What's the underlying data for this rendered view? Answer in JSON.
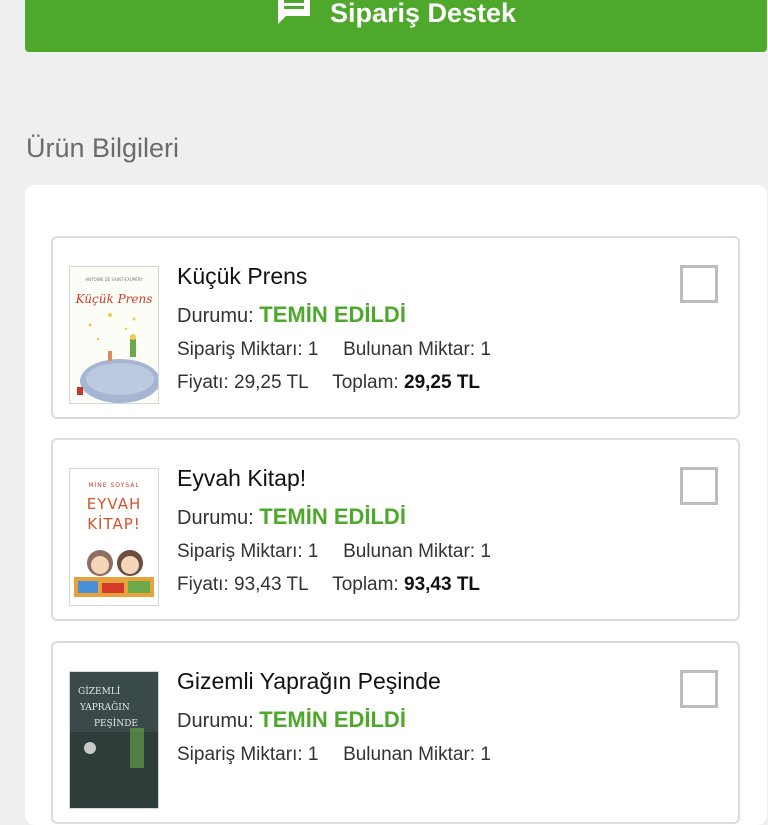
{
  "support_button": {
    "label": "Sipariş Destek",
    "icon": "chat-icon",
    "color": "#4ea82c"
  },
  "section": {
    "title": "Ürün Bilgileri"
  },
  "labels": {
    "status": "Durumu:",
    "order_qty": "Sipariş Miktarı:",
    "found_qty": "Bulunan Miktar:",
    "price": "Fiyatı:",
    "total": "Toplam:"
  },
  "products": [
    {
      "title": "Küçük Prens",
      "status": "TEMİN EDİLDİ",
      "order_qty": "1",
      "found_qty": "1",
      "price": "29,25 TL",
      "total": "29,25 TL",
      "cover_text": "Küçük Prens"
    },
    {
      "title": "Eyvah Kitap!",
      "status": "TEMİN EDİLDİ",
      "order_qty": "1",
      "found_qty": "1",
      "price": "93,43 TL",
      "total": "93,43 TL",
      "cover_author": "MİNE SOYSAL",
      "cover_title_1": "EYVAH",
      "cover_title_2": "KİTAP!"
    },
    {
      "title": "Gizemli Yaprağın Peşinde",
      "status": "TEMİN EDİLDİ",
      "order_qty": "1",
      "found_qty": "1",
      "price": "",
      "total": ""
    }
  ],
  "colors": {
    "accent_green": "#4ea82c",
    "checkbox_border": "#bdbdbd"
  }
}
